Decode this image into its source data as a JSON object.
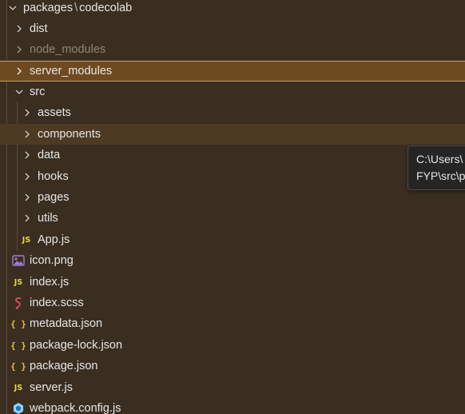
{
  "header": {
    "path_part1": "packages",
    "path_separator": "\\",
    "path_part2": "codecolab"
  },
  "tree": {
    "dist": "dist",
    "node_modules": "node_modules",
    "server_modules": "server_modules",
    "src": "src",
    "assets": "assets",
    "components": "components",
    "data": "data",
    "hooks": "hooks",
    "pages": "pages",
    "utils": "utils",
    "app_js": "App.js",
    "icon_png": "icon.png",
    "index_js": "index.js",
    "index_scss": "index.scss",
    "metadata_json": "metadata.json",
    "package_lock_json": "package-lock.json",
    "package_json": "package.json",
    "server_js": "server.js",
    "webpack_config_js": "webpack.config.js"
  },
  "icons": {
    "js_glyph": "JS",
    "json_glyph": "{ }"
  },
  "tooltip": {
    "line1": "C:\\Users\\",
    "line2": "FYP\\src\\p"
  },
  "colors": {
    "background": "#3a2e21",
    "selected": "#6e4a20",
    "hover": "#4d3a22",
    "js": "#e8d44d",
    "json": "#e8c03c",
    "scss": "#f0506e",
    "image": "#a07cd8",
    "webpack": "#8ed6fb"
  }
}
